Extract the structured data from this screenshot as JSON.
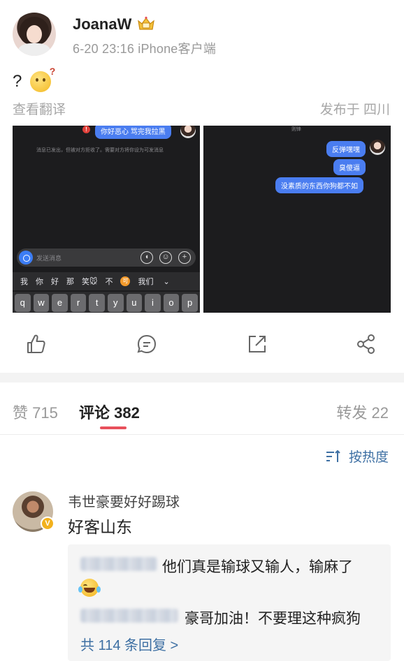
{
  "post": {
    "username": "JoanaW",
    "meta": "6-20 23:16 iPhone客户端",
    "text": "?",
    "translate": "查看翻译",
    "location": "发布于 四川"
  },
  "screenshot_left": {
    "top_bubble": "你好恶心 骂完我拉黑",
    "system_msg": "消息已发出，但被对方拒收了。需要对方将你设为可发消息",
    "input_placeholder": "发送消息",
    "candidates": [
      "我",
      "你",
      "好",
      "那",
      "笑🐭",
      "不",
      "可",
      "我们"
    ],
    "keys": [
      "q",
      "w",
      "e",
      "r",
      "t",
      "y",
      "u",
      "i",
      "o",
      "p"
    ]
  },
  "screenshot_right": {
    "top_name": "则锋",
    "bubbles": [
      "反弹嘿嘿",
      "臭傻逼",
      "没素质的东西你狗都不如"
    ]
  },
  "actions": [
    {
      "name": "like",
      "icon": "thumbs-up-icon"
    },
    {
      "name": "comment",
      "icon": "comment-icon"
    },
    {
      "name": "repost",
      "icon": "repost-icon"
    },
    {
      "name": "share",
      "icon": "share-icon"
    }
  ],
  "tabs": {
    "likes": "赞 715",
    "comments": "评论 382",
    "reposts": "转发 22"
  },
  "sort": {
    "label": "按热度"
  },
  "comment": {
    "name": "韦世豪要好好踢球",
    "text": "好客山东",
    "badge": "V",
    "replies": [
      {
        "text": "他们真是输球又输人，输麻了"
      },
      {
        "text": "豪哥加油！不要理这种疯狗"
      }
    ],
    "more": "共 114 条回复 >"
  },
  "colors": {
    "accent_red": "#e8505b",
    "link_blue": "#3d6fa3",
    "chat_bubble": "#4a7df0"
  }
}
